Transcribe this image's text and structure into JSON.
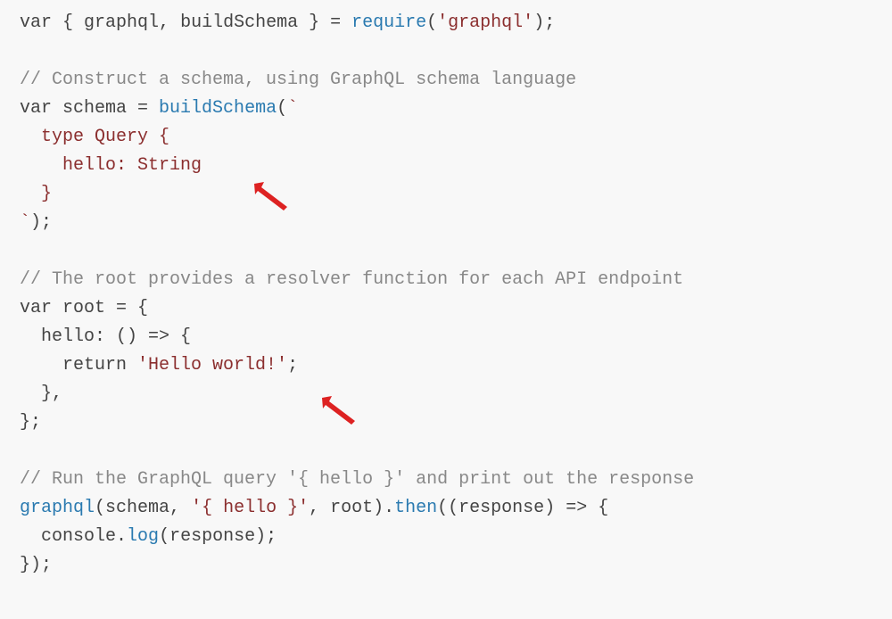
{
  "code": {
    "l1_var": "var",
    "l1_lbrace": " { ",
    "l1_graphql": "graphql",
    "l1_comma": ", ",
    "l1_buildSchema": "buildSchema",
    "l1_rbrace": " } ",
    "l1_eq": "= ",
    "l1_require": "require",
    "l1_lparen": "(",
    "l1_str": "'graphql'",
    "l1_rparen": ");",
    "l3_comment": "// Construct a schema, using GraphQL schema language",
    "l4_var": "var",
    "l4_schema": " schema ",
    "l4_eq": "= ",
    "l4_buildSchema": "buildSchema",
    "l4_lparen": "(",
    "l4_tick": "`",
    "l5": "  type Query {",
    "l6": "    hello: String",
    "l7": "  }",
    "l8_tick": "`",
    "l8_rparen": ");",
    "l10_comment": "// The root provides a resolver function for each API endpoint",
    "l11_var": "var",
    "l11_root": " root ",
    "l11_eq": "= {",
    "l12_hello": "  hello",
    "l12_colon": ": () ",
    "l12_arrow": "=>",
    "l12_brace": " {",
    "l13_return": "    return ",
    "l13_str": "'Hello world!'",
    "l13_semi": ";",
    "l14": "  },",
    "l15": "};",
    "l17_comment": "// Run the GraphQL query '{ hello }' and print out the response",
    "l18_graphql": "graphql",
    "l18_lparen": "(",
    "l18_schema": "schema",
    "l18_comma1": ", ",
    "l18_str": "'{ hello }'",
    "l18_comma2": ", ",
    "l18_root": "root",
    "l18_rparen": ").",
    "l18_then": "then",
    "l18_lparen2": "((",
    "l18_response": "response",
    "l18_rparen2": ") ",
    "l18_arrow": "=>",
    "l18_brace": " {",
    "l19_console": "  console",
    "l19_dot": ".",
    "l19_log": "log",
    "l19_lparen": "(",
    "l19_response": "response",
    "l19_rparen": ");",
    "l20": "});"
  },
  "annotations": {
    "arrow1_target": "schema-definition",
    "arrow2_target": "resolver-return"
  }
}
